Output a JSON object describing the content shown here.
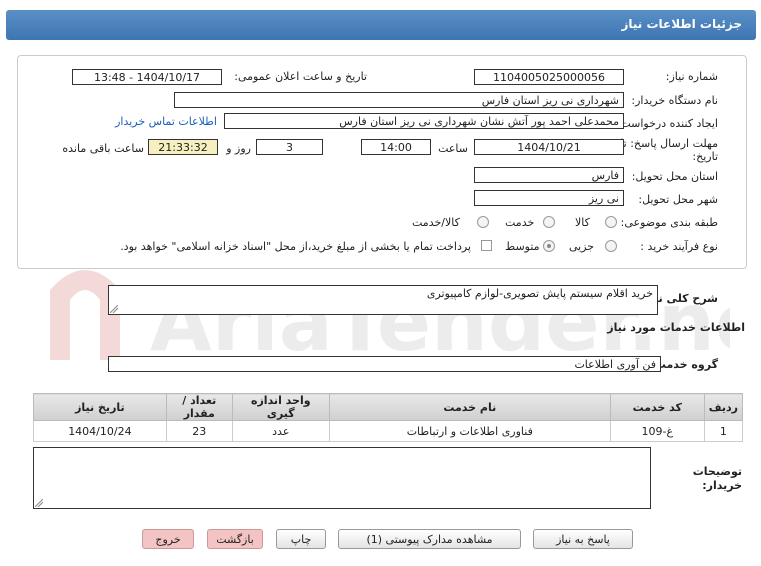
{
  "header": {
    "title": "جزئیات اطلاعات نیاز"
  },
  "form": {
    "need_number_label": "شماره نیاز:",
    "need_number": "1104005025000056",
    "announce_label": "تاریخ و ساعت اعلان عمومی:",
    "announce_value": "1404/10/17 - 13:48",
    "buyer_label": "نام دستگاه خریدار:",
    "buyer_value": "شهرداری نی ریز استان فارس",
    "creator_label": "ایجاد کننده درخواست:",
    "creator_value": "محمدعلی احمد پور آتش نشان شهرداری نی ریز استان فارس",
    "contact_link": "اطلاعات تماس خریدار",
    "deadline_label_1": "مهلت ارسال پاسخ: تا",
    "deadline_label_2": "تاریخ:",
    "deadline_date": "1404/10/21",
    "time_label": "ساعت",
    "deadline_time": "14:00",
    "days_value": "3",
    "days_label": "روز و",
    "remaining_time": "21:33:32",
    "remaining_label": "ساعت باقی مانده",
    "province_label": "استان محل تحویل:",
    "province_value": "فارس",
    "city_label": "شهر محل تحویل:",
    "city_value": "نی ریز",
    "category_label": "طبقه بندی موضوعی:",
    "category_options": [
      "کالا",
      "خدمت",
      "کالا/خدمت"
    ],
    "process_label": "نوع فرآیند خرید :",
    "process_options": [
      "جزیی",
      "متوسط"
    ],
    "payment_text": "پرداخت تمام یا بخشی از مبلغ خرید،از محل \"اسناد خزانه اسلامی\" خواهد بود."
  },
  "description": {
    "label": "شرح کلی نیاز:",
    "value": "خرید اقلام سیستم پایش تصویری-لوازم کامپیوتری"
  },
  "services": {
    "section_title": "اطلاعات خدمات مورد نیاز",
    "group_label": "گروه خدمت:",
    "group_value": "فن آوری اطلاعات",
    "columns": [
      "ردیف",
      "کد خدمت",
      "نام خدمت",
      "واحد اندازه گیری",
      "تعداد / مقدار",
      "تاریخ نیاز"
    ],
    "rows": [
      {
        "index": "1",
        "code": "غ-109",
        "name": "فناوری اطلاعات و ارتباطات",
        "unit": "عدد",
        "qty": "23",
        "date": "1404/10/24"
      }
    ]
  },
  "notes": {
    "label_1": "توضیحات",
    "label_2": "خریدار:",
    "value": ""
  },
  "buttons": {
    "reply": "پاسخ به نیاز",
    "attachments": "مشاهده مدارک پیوستی (1)",
    "print": "چاپ",
    "back": "بازگشت",
    "exit": "خروج"
  },
  "watermark": {
    "text": "AriaTender.net"
  },
  "colors": {
    "header": "#3e76b3",
    "link": "#1a5fb4",
    "highlight": "#f6f0c0",
    "pink_button": "#f4c4c4"
  }
}
